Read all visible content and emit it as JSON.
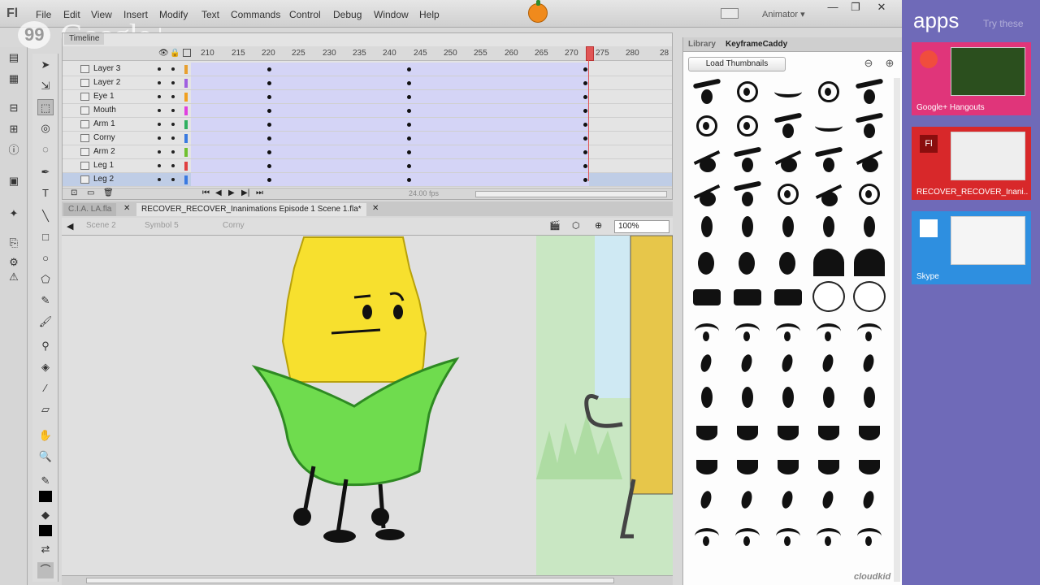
{
  "menubar": {
    "logo": "Fl",
    "items": [
      "File",
      "Edit",
      "View",
      "Insert",
      "Modify",
      "Text",
      "Commands",
      "Control",
      "Debug",
      "Window",
      "Help"
    ],
    "workspace": "Animator ▾",
    "window_buttons": [
      "—",
      "❐",
      "✕"
    ]
  },
  "google_logo": "Google+",
  "timeline": {
    "tab": "Timeline",
    "frame_numbers": [
      "210",
      "215",
      "220",
      "225",
      "230",
      "235",
      "240",
      "245",
      "250",
      "255",
      "260",
      "265",
      "270",
      "275",
      "280",
      "28"
    ],
    "layers": [
      {
        "name": "Layer 3",
        "color": "#e8a030"
      },
      {
        "name": "Layer 2",
        "color": "#a060e0"
      },
      {
        "name": "Eye 1",
        "color": "#f0a020"
      },
      {
        "name": "Mouth",
        "color": "#e040e0"
      },
      {
        "name": "Arm 1",
        "color": "#30b060"
      },
      {
        "name": "Corny",
        "color": "#3a7ae0"
      },
      {
        "name": "Arm 2",
        "color": "#70c030"
      },
      {
        "name": "Leg 1",
        "color": "#e04040"
      },
      {
        "name": "Leg 2",
        "color": "#3a7ae0"
      }
    ],
    "fps": "24.00 fps"
  },
  "doc_tabs": [
    "C.I.A. LA.fla",
    "RECOVER_RECOVER_Inanimations Episode 1 Scene 1.fla*"
  ],
  "edit_bar": {
    "scene": "Scene 2",
    "symbol": "Symbol 5",
    "item": "Corny",
    "zoom": "100%"
  },
  "library": {
    "tabs": [
      "Library",
      "KeyframeCaddy"
    ],
    "load_button": "Load Thumbnails",
    "brand": "cloudkid"
  },
  "apps": {
    "title": "apps",
    "subtitle": "Try these",
    "tiles": [
      {
        "label": "Google+ Hangouts",
        "color": "#e0357a"
      },
      {
        "label": "RECOVER_RECOVER_Inani...",
        "color": "#d8282a"
      },
      {
        "label": "Skype",
        "color": "#2e8fe0"
      }
    ]
  }
}
